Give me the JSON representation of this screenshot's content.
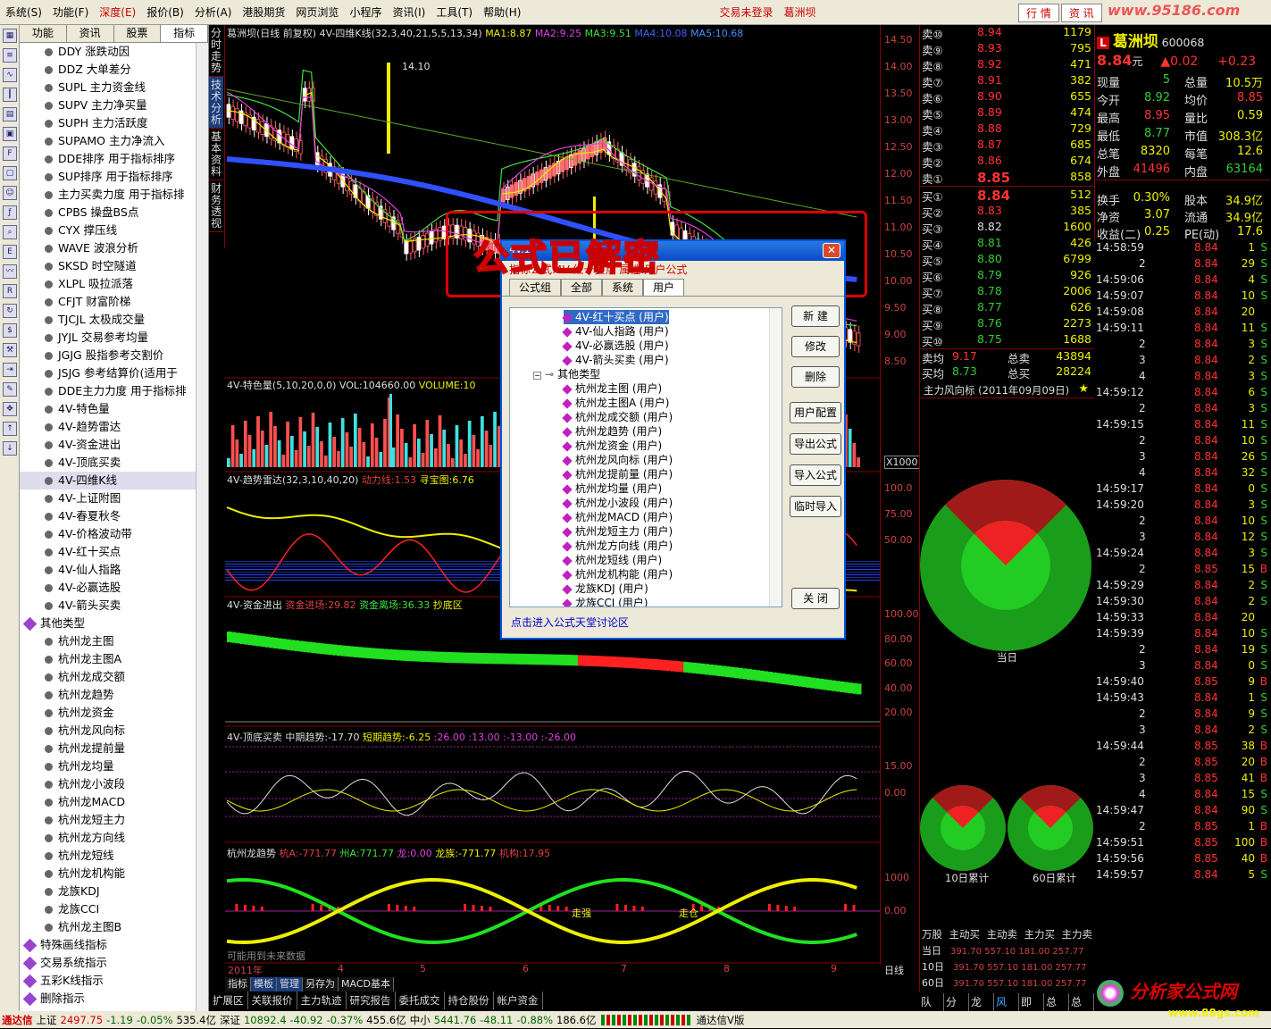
{
  "menu": {
    "items": [
      "系统(S)",
      "功能(F)",
      "深度(E)",
      "报价(B)",
      "分析(A)",
      "港股期货",
      "网页浏览",
      "小程序",
      "资讯(I)",
      "工具(T)",
      "帮助(H)"
    ],
    "login": "交易未登录",
    "stock_name": "葛洲坝",
    "btn1": "行 情",
    "btn2": "资 讯",
    "watermark": "www.95186.com"
  },
  "left": {
    "tabs": [
      "功能",
      "资讯",
      "股票",
      "指标"
    ],
    "items": [
      "DDY 涨跌动因",
      "DDZ 大单差分",
      "SUPL 主力资金线",
      "SUPV 主力净买量",
      "SUPH 主力活跃度",
      "SUPAMO 主力净流入",
      "DDE排序 用于指标排序",
      "SUP排序 用于指标排序",
      "主力买卖力度 用于指标排",
      "CPBS 操盘BS点",
      "CYX 撑压线",
      "WAVE 波浪分析",
      "SKSD 时空隧道",
      "XLPL 吸拉派落",
      "CFJT 财富阶梯",
      "TJCJL 太极成交量",
      "JYJL 交易参考均量",
      "JGJG 股指参考交割价",
      "JSJG 参考结算价(适用于",
      "DDE主力力度 用于指标排",
      "4V-特色量",
      "4V-趋势雷达",
      "4V-资金进出",
      "4V-顶底买卖",
      "4V-四维K线",
      "4V-上证附图",
      "4V-春夏秋冬",
      "4V-价格波动带",
      "4V-红十买点",
      "4V-仙人指路",
      "4V-必赢选股",
      "4V-箭头买卖"
    ],
    "cat": "其他类型",
    "items2": [
      "杭州龙主图",
      "杭州龙主图A",
      "杭州龙成交额",
      "杭州龙趋势",
      "杭州龙资金",
      "杭州龙风向标",
      "杭州龙提前量",
      "杭州龙均量",
      "杭州龙小波段",
      "杭州龙MACD",
      "杭州龙短主力",
      "杭州龙方向线",
      "杭州龙短线",
      "杭州龙机构能",
      "龙族KDJ",
      "龙族CCI",
      "杭州龙主图B"
    ],
    "cats2": [
      "特殊画线指标",
      "交易系统指示",
      "五彩K线指示",
      "删除指示"
    ]
  },
  "vtabs": [
    "分时走势",
    "技术分析",
    "基本资料",
    "财务透视"
  ],
  "chart": {
    "title": "葛洲坝(日线 前复权) 4V-四维K线(32,3,40,21,5,5,13,34)",
    "ma": [
      "MA1:8.87",
      "MA2:9.25",
      "MA3:9.51",
      "MA4:10.08",
      "MA5:10.68"
    ],
    "peak": "14.10",
    "vol_title": "4V-特色量(5,10,20,0,0)",
    "vol_val": "VOL:104660.00",
    "vol_v2": "VOLUME:10",
    "radar_title": "4V-趋势雷达(32,3,10,40,20)",
    "radar_a": "动力线:1.53",
    "radar_b": "寻宝图:6.76",
    "fund_title": "4V-资金进出",
    "fund_a": "资金进场:29.82",
    "fund_b": "资金离场:36.33",
    "fund_c": "抄底区",
    "top_title": "4V-顶底买卖",
    "top_a": "中期趋势:-17.70",
    "top_b": "短期趋势:-6.25",
    "top_c": ":26.00",
    ":13.00": ":13.00",
    "top_d": ":13.00",
    "top_e": ":-13.00",
    "top_f": ":-26.00",
    "hz_title": "杭州龙趋势",
    "hz_a": "杭A:-771.77",
    "hz_b": "州A:771.77",
    "hz_c": "龙:0.00",
    "hz_d": "龙族:-771.77",
    "hz_e": "机构:17.95",
    "hz_label1": "走强",
    "hz_label2": "走仓",
    "future": "可能用到未来数据",
    "years": [
      "2011年",
      "4",
      "5",
      "6",
      "7",
      "8",
      "9"
    ],
    "x1000": "X1000",
    "period": "日线"
  },
  "axis": {
    "price": [
      "14.50",
      "14.00",
      "13.50",
      "13.00",
      "12.50",
      "12.00",
      "11.50",
      "11.00",
      "10.50",
      "10.00",
      "9.50",
      "9.00",
      "8.50"
    ],
    "radar": [
      "100.0",
      "75.00",
      "50.00"
    ],
    "fund": [
      "100.00",
      "80.00",
      "60.00",
      "40.00",
      "20.00"
    ],
    "top": [
      "15.00",
      "0.00"
    ],
    "hz": [
      "1000",
      "0.00"
    ]
  },
  "bottom_tabs": [
    "指标",
    "模板",
    "管理",
    "另存为",
    "MACD基本"
  ],
  "footer_tabs": [
    "扩展区",
    "关联报价",
    "主力轨迹",
    "研究报告",
    "委托成交",
    "持仓股份",
    "帐户资金"
  ],
  "quote": {
    "sell": [
      {
        "l": "卖⑩",
        "p": "8.94",
        "v": "1179"
      },
      {
        "l": "卖⑨",
        "p": "8.93",
        "v": "795"
      },
      {
        "l": "卖⑧",
        "p": "8.92",
        "v": "471"
      },
      {
        "l": "卖⑦",
        "p": "8.91",
        "v": "382"
      },
      {
        "l": "卖⑥",
        "p": "8.90",
        "v": "655"
      },
      {
        "l": "卖⑤",
        "p": "8.89",
        "v": "474"
      },
      {
        "l": "卖④",
        "p": "8.88",
        "v": "729"
      },
      {
        "l": "卖③",
        "p": "8.87",
        "v": "685"
      },
      {
        "l": "卖②",
        "p": "8.86",
        "v": "674"
      },
      {
        "l": "卖①",
        "p": "8.85",
        "v": "858"
      }
    ],
    "buy": [
      {
        "l": "买①",
        "p": "8.84",
        "v": "512"
      },
      {
        "l": "买②",
        "p": "8.83",
        "v": "385"
      },
      {
        "l": "买③",
        "p": "8.82",
        "v": "1600"
      },
      {
        "l": "买④",
        "p": "8.81",
        "v": "426"
      },
      {
        "l": "买⑤",
        "p": "8.80",
        "v": "6799"
      },
      {
        "l": "买⑥",
        "p": "8.79",
        "v": "926"
      },
      {
        "l": "买⑦",
        "p": "8.78",
        "v": "2006"
      },
      {
        "l": "买⑧",
        "p": "8.77",
        "v": "626"
      },
      {
        "l": "买⑨",
        "p": "8.76",
        "v": "2273"
      },
      {
        "l": "买⑩",
        "p": "8.75",
        "v": "1688"
      }
    ],
    "avg_sell_l": "卖均",
    "avg_sell_p": "9.17",
    "tot_sell_l": "总卖",
    "tot_sell_v": "43894",
    "avg_buy_l": "买均",
    "avg_buy_p": "8.73",
    "tot_buy_l": "总买",
    "tot_buy_v": "28224"
  },
  "mainforce": {
    "title": "主力风向标 (2011年09月09日)",
    "today": "当日",
    "d10": "10日累计",
    "d60": "60日累计",
    "table_head": [
      "万股",
      "主动买",
      "主动卖",
      "主力买",
      "主力卖"
    ],
    "rows": [
      {
        "l": "当日",
        "v": "391.70 557.10 181.00 257.77"
      },
      {
        "l": "10日",
        "v": "391.70 557.10 181.00 257.77"
      },
      {
        "l": "60日",
        "v": "391.70 557.10 181.00 257.77"
      }
    ]
  },
  "info": {
    "name": "葛洲坝",
    "code": "600068",
    "price": "8.84",
    "unit": "元",
    "chg": "▲0.02",
    "chg2": "+0.23",
    "rows": [
      [
        "现量",
        "5",
        "总量",
        "10.5万"
      ],
      [
        "今开",
        "8.92",
        "均价",
        "8.85"
      ],
      [
        "最高",
        "8.95",
        "量比",
        "0.59"
      ],
      [
        "最低",
        "8.77",
        "市值",
        "308.3亿"
      ],
      [
        "总笔",
        "8320",
        "每笔",
        "12.6"
      ],
      [
        "外盘",
        "41496",
        "内盘",
        "63164"
      ],
      [
        "换手",
        "0.30%",
        "股本",
        "34.9亿"
      ],
      [
        "净资",
        "3.07",
        "流通",
        "34.9亿"
      ],
      [
        "收益(二)",
        "0.25",
        "PE(动)",
        "17.6"
      ]
    ]
  },
  "ticks": [
    [
      "14:58:59",
      "8.84",
      "1",
      "S"
    ],
    [
      "2",
      "8.84",
      "29",
      "S"
    ],
    [
      "14:59:06",
      "8.84",
      "4",
      "S"
    ],
    [
      "14:59:07",
      "8.84",
      "10",
      "S"
    ],
    [
      "14:59:08",
      "8.84",
      "20",
      ""
    ],
    [
      "14:59:11",
      "8.84",
      "11",
      "S"
    ],
    [
      "2",
      "8.84",
      "3",
      "S"
    ],
    [
      "3",
      "8.84",
      "2",
      "S"
    ],
    [
      "4",
      "8.84",
      "3",
      "S"
    ],
    [
      "14:59:12",
      "8.84",
      "6",
      "S"
    ],
    [
      "2",
      "8.84",
      "3",
      "S"
    ],
    [
      "14:59:15",
      "8.84",
      "11",
      "S"
    ],
    [
      "2",
      "8.84",
      "10",
      "S"
    ],
    [
      "3",
      "8.84",
      "26",
      "S"
    ],
    [
      "4",
      "8.84",
      "32",
      "S"
    ],
    [
      "14:59:17",
      "8.84",
      "0",
      "S"
    ],
    [
      "14:59:20",
      "8.84",
      "3",
      "S"
    ],
    [
      "2",
      "8.84",
      "10",
      "S"
    ],
    [
      "3",
      "8.84",
      "12",
      "S"
    ],
    [
      "14:59:24",
      "8.84",
      "3",
      "S"
    ],
    [
      "2",
      "8.85",
      "15",
      "B"
    ],
    [
      "14:59:29",
      "8.84",
      "2",
      "S"
    ],
    [
      "14:59:30",
      "8.84",
      "2",
      "S"
    ],
    [
      "14:59:33",
      "8.84",
      "20",
      ""
    ],
    [
      "14:59:39",
      "8.84",
      "10",
      "S"
    ],
    [
      "2",
      "8.84",
      "19",
      "S"
    ],
    [
      "3",
      "8.84",
      "0",
      "S"
    ],
    [
      "14:59:40",
      "8.85",
      "9",
      "B"
    ],
    [
      "14:59:43",
      "8.84",
      "1",
      "S"
    ],
    [
      "2",
      "8.84",
      "9",
      "S"
    ],
    [
      "3",
      "8.84",
      "2",
      "S"
    ],
    [
      "14:59:44",
      "8.85",
      "38",
      "B"
    ],
    [
      "2",
      "8.85",
      "20",
      "B"
    ],
    [
      "3",
      "8.85",
      "41",
      "B"
    ],
    [
      "4",
      "8.84",
      "15",
      "S"
    ],
    [
      "14:59:47",
      "8.84",
      "90",
      "S"
    ],
    [
      "2",
      "8.85",
      "1",
      "B"
    ],
    [
      "14:59:51",
      "8.85",
      "100",
      "B"
    ],
    [
      "14:59:56",
      "8.85",
      "40",
      "B"
    ],
    [
      "14:59:57",
      "8.84",
      "5",
      "S"
    ]
  ],
  "rtabs": [
    "队列",
    "分布",
    "龙虎",
    "风向",
    "即撤",
    "总撤",
    "总委"
  ],
  "status": {
    "brand": "通达信",
    "sh_l": "上证",
    "sh_v": "2497.75",
    "sh_c": "-1.19",
    "sh_p": "-0.05%",
    "sh_a": "535.4亿",
    "sz_l": "深证",
    "sz_v": "10892.4",
    "sz_c": "-40.92",
    "sz_p": "-0.37%",
    "sz_a": "455.6亿",
    "zx_l": "中小",
    "zx_v": "5441.76",
    "zx_c": "-48.11",
    "zx_p": "-0.88%",
    "zx_a": "186.6亿",
    "ver": "通达信V版"
  },
  "dialog": {
    "sub": "指标公式:4V-红十买点 属性:用户公式",
    "tabs": [
      "公式组",
      "全部",
      "系统",
      "用户"
    ],
    "items_top": [
      "4V-红十买点 (用户)",
      "4V-仙人指路 (用户)",
      "4V-必赢选股 (用户)",
      "4V-箭头买卖 (用户)"
    ],
    "cat": "其他类型",
    "items": [
      "杭州龙主图 (用户)",
      "杭州龙主图A (用户)",
      "杭州龙成交额 (用户)",
      "杭州龙趋势 (用户)",
      "杭州龙资金 (用户)",
      "杭州龙风向标 (用户)",
      "杭州龙提前量 (用户)",
      "杭州龙均量 (用户)",
      "杭州龙小波段 (用户)",
      "杭州龙MACD (用户)",
      "杭州龙短主力 (用户)",
      "杭州龙方向线 (用户)",
      "杭州龙短线 (用户)",
      "杭州龙机构能 (用户)",
      "龙族KDJ (用户)",
      "龙族CCI (用户)"
    ],
    "buttons": [
      "新 建",
      "修改",
      "删除",
      "用户配置",
      "导出公式",
      "导入公式",
      "临时导入",
      "关 闭"
    ],
    "link": "点击进入公式天堂讨论区",
    "overlay": "公式已解密",
    "behind": "4V.1"
  },
  "logo": {
    "text": "分析家公式网",
    "url": "www.88gs.com"
  }
}
